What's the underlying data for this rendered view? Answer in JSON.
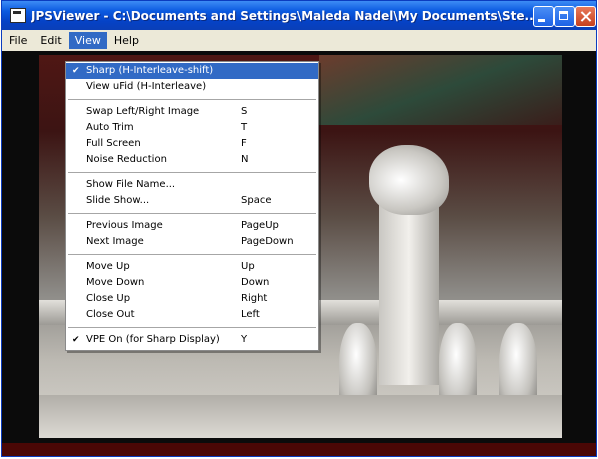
{
  "window": {
    "title": "JPSViewer - C:\\Documents and Settings\\Maleda Nadel\\My Documents\\Ste..."
  },
  "menubar": {
    "items": [
      "File",
      "Edit",
      "View",
      "Help"
    ],
    "active": "View"
  },
  "view_menu": {
    "items": [
      {
        "label": "Sharp (H-Interleave-shift)",
        "shortcut": "",
        "checked": true,
        "highlighted": true
      },
      {
        "label": "View uFid (H-Interleave)",
        "shortcut": "",
        "checked": false
      },
      {
        "separator": true
      },
      {
        "label": "Swap Left/Right Image",
        "shortcut": "S",
        "checked": false
      },
      {
        "label": "Auto Trim",
        "shortcut": "T",
        "checked": false
      },
      {
        "label": "Full Screen",
        "shortcut": "F",
        "checked": false
      },
      {
        "label": "Noise Reduction",
        "shortcut": "N",
        "checked": false
      },
      {
        "separator": true
      },
      {
        "label": "Show File Name...",
        "shortcut": "",
        "checked": false
      },
      {
        "label": "Slide Show...",
        "shortcut": "Space",
        "checked": false
      },
      {
        "separator": true
      },
      {
        "label": "Previous Image",
        "shortcut": "PageUp",
        "checked": false
      },
      {
        "label": "Next Image",
        "shortcut": "PageDown",
        "checked": false
      },
      {
        "separator": true
      },
      {
        "label": "Move Up",
        "shortcut": "Up",
        "checked": false
      },
      {
        "label": "Move Down",
        "shortcut": "Down",
        "checked": false
      },
      {
        "label": "Close Up",
        "shortcut": "Right",
        "checked": false
      },
      {
        "label": "Close Out",
        "shortcut": "Left",
        "checked": false
      },
      {
        "separator": true
      },
      {
        "label": "VPE On (for Sharp Display)",
        "shortcut": "Y",
        "checked": true
      }
    ]
  },
  "icons": {
    "app": "app-icon",
    "check": "✔",
    "minimize": "minimize-icon",
    "maximize": "maximize-icon",
    "close": "close-icon"
  },
  "colors": {
    "titlebar": "#0b5ae0",
    "menu_highlight": "#316ac5",
    "close_button": "#c7401e"
  }
}
